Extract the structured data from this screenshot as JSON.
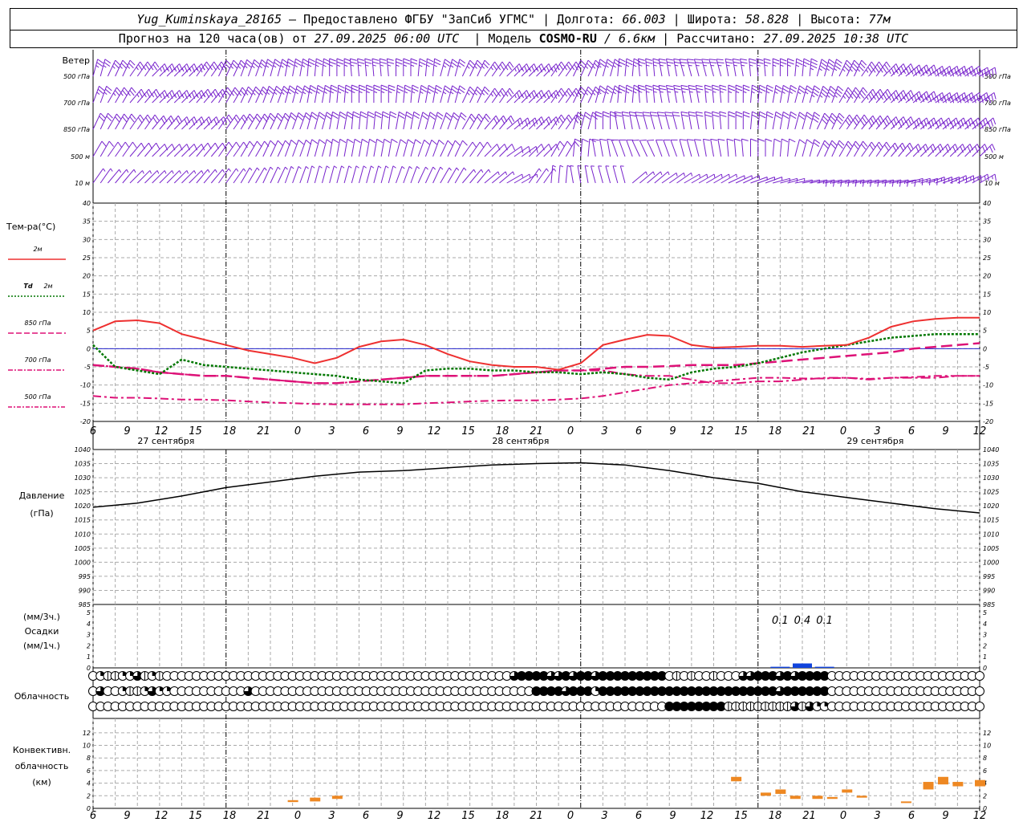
{
  "header": {
    "station": "Yug_Kuminskaya_28165",
    "provider": "– Предоставлено ФГБУ \"ЗапСиб УГМС\"",
    "lon_label": "Долгота:",
    "lon": "66.003",
    "lat_label": "Широта:",
    "lat": "58.828",
    "alt_label": "Высота:",
    "alt": "77м",
    "forecast_prefix": "Прогноз на 120 часа(ов) от",
    "forecast_time": "27.09.2025 06:00 UTC",
    "model_label": "Модель",
    "model": "COSMO-RU",
    "resolution": "/ 6.6км",
    "calc_label": "Рассчитано:",
    "calc_time": "27.09.2025 10:38 UTC"
  },
  "colors": {
    "t2m": "#ee3030",
    "td2m": "#007700",
    "t850": "#dd1177",
    "t700": "#dd1177",
    "t500": "#dd1177",
    "zero_line": "#2222cc",
    "wind": "#7722cc",
    "pressure": "#000000",
    "precip": "#1144dd",
    "convective": "#ee8822"
  },
  "wind_panel": {
    "title": "Ветер",
    "levels": [
      "500 гПа",
      "700 гПа",
      "850 гПа",
      "500 м",
      "10 м"
    ]
  },
  "temp_panel": {
    "title": "Тем-ра(°C)",
    "legend": [
      {
        "key": "t2m",
        "label": "2м"
      },
      {
        "key": "td2m",
        "label_prefix": "Td",
        "label": "2м"
      },
      {
        "key": "t850",
        "label": "850 гПа"
      },
      {
        "key": "t700",
        "label": "700 гПа"
      },
      {
        "key": "t500",
        "label": "500 гПа"
      }
    ],
    "yticks": [
      "40",
      "35",
      "30",
      "25",
      "20",
      "15",
      "10",
      "5",
      "0",
      "-5",
      "-10",
      "-15",
      "-20"
    ],
    "dates": [
      "27 сентября",
      "28 сентября",
      "29 сентября"
    ]
  },
  "pressure_panel": {
    "title": "Давление",
    "unit": "(гПа)",
    "yticks": [
      "1040",
      "1035",
      "1030",
      "1025",
      "1020",
      "1015",
      "1010",
      "1005",
      "1000",
      "995",
      "990",
      "985"
    ]
  },
  "precip_panel": {
    "unit1": "(мм/3ч.)",
    "title": "Осадки",
    "unit2": "(мм/1ч.)",
    "yticks": [
      "5",
      "4",
      "3",
      "2",
      "1",
      "0"
    ],
    "annotations": [
      "0.1",
      "0.4",
      "0.1"
    ]
  },
  "cloud_panel": {
    "title": "Облачность"
  },
  "conv_panel": {
    "title1": "Конвективн.",
    "title2": "облачность",
    "unit": "(км)",
    "yticks": [
      "12",
      "10",
      "8",
      "6",
      "4",
      "2",
      "0"
    ]
  },
  "x_ticks": [
    "6",
    "9",
    "12",
    "15",
    "18",
    "21",
    "0",
    "3",
    "6",
    "9",
    "12",
    "15",
    "18",
    "21",
    "0",
    "3",
    "6",
    "9",
    "12",
    "15",
    "18",
    "21",
    "0",
    "3",
    "6",
    "9",
    "12"
  ],
  "chart_data": [
    {
      "type": "line",
      "title": "Тем-ра(°C)",
      "x": [
        0,
        3,
        6,
        9,
        12,
        15,
        18,
        21,
        24,
        27,
        30,
        33,
        36,
        39,
        42,
        45,
        48,
        51,
        54,
        57,
        60,
        63,
        66,
        69,
        72,
        75,
        78,
        81,
        84,
        87,
        90,
        93,
        96,
        99,
        102,
        105,
        108,
        111,
        114,
        117,
        120
      ],
      "x_unit": "hours from 27.09.2025 06 UTC",
      "ylim": [
        -20,
        40
      ],
      "series": [
        {
          "name": "2м",
          "values": [
            5,
            7.5,
            7.8,
            7,
            4,
            2.5,
            1,
            -0.5,
            -1.5,
            -2.5,
            -4,
            -2.5,
            0.5,
            2,
            2.5,
            1,
            -1.5,
            -3.5,
            -4.5,
            -5,
            -5,
            -5.8,
            -4,
            1,
            2.5,
            3.8,
            3.5,
            1,
            0.3,
            0.5,
            0.8,
            0.8,
            0.5,
            0.8,
            1,
            3,
            6,
            7.5,
            8.2,
            8.5,
            8.5
          ]
        },
        {
          "name": "Td 2м",
          "values": [
            1,
            -5,
            -6,
            -7,
            -3,
            -4.5,
            -5,
            -5.5,
            -6,
            -6.5,
            -7,
            -7.5,
            -8.5,
            -9,
            -9.5,
            -6,
            -5.5,
            -5.5,
            -6,
            -6,
            -6.5,
            -6.5,
            -7,
            -6.5,
            -7,
            -8,
            -8.5,
            -6.5,
            -5.5,
            -5,
            -4,
            -2.5,
            -1,
            0,
            1,
            2,
            3,
            3.5,
            4,
            4,
            4
          ]
        },
        {
          "name": "850 гПа",
          "values": [
            -4.5,
            -5,
            -5.5,
            -6.5,
            -7,
            -7.5,
            -7.5,
            -8,
            -8.5,
            -9,
            -9.5,
            -9.5,
            -9,
            -8.5,
            -8,
            -7.5,
            -7.5,
            -7.5,
            -7.5,
            -7,
            -6.5,
            -6,
            -6,
            -5.5,
            -5,
            -5,
            -4.8,
            -4.5,
            -4.5,
            -4.5,
            -4,
            -3.5,
            -3,
            -2.5,
            -2,
            -1.5,
            -1,
            0,
            0.5,
            1,
            1.5
          ]
        },
        {
          "name": "700 гПа",
          "values": [
            -4.5,
            -5,
            -5.5,
            -6.5,
            -7,
            -7.5,
            -7.5,
            -8,
            -8.5,
            -9,
            -9.5,
            -9.5,
            -9,
            -8.5,
            -8,
            -7.5,
            -7.5,
            -7.5,
            -7.5,
            -7,
            -6.5,
            -6,
            -6,
            -6,
            -7,
            -7.5,
            -7.5,
            -8.5,
            -9.5,
            -9.5,
            -9,
            -9,
            -8.5,
            -8,
            -8,
            -8.5,
            -8,
            -8,
            -8,
            -7.5,
            -7.5
          ]
        },
        {
          "name": "500 гПа",
          "values": [
            -13,
            -13.5,
            -13.5,
            -13.7,
            -14,
            -14,
            -14.2,
            -14.5,
            -14.8,
            -15,
            -15.2,
            -15.3,
            -15.3,
            -15.3,
            -15.3,
            -15,
            -14.8,
            -14.5,
            -14.3,
            -14.2,
            -14.2,
            -14,
            -13.7,
            -13,
            -12,
            -11,
            -10,
            -9.5,
            -9,
            -8.5,
            -8,
            -8,
            -8.2,
            -8.2,
            -8,
            -8.3,
            -8,
            -7.8,
            -7.5,
            -7.5,
            -7.5
          ]
        }
      ]
    },
    {
      "type": "line",
      "title": "Давление",
      "ylabel": "(гПа)",
      "ylim": [
        985,
        1040
      ],
      "x": [
        0,
        6,
        12,
        18,
        24,
        30,
        36,
        42,
        48,
        54,
        60,
        66,
        72,
        78,
        84,
        90,
        96,
        102,
        108,
        114,
        120
      ],
      "series": [
        {
          "name": "Давление",
          "values": [
            1019.5,
            1021,
            1023.5,
            1026.5,
            1028.5,
            1030.5,
            1032,
            1032.5,
            1033.5,
            1034.5,
            1035,
            1035.3,
            1034.5,
            1032.5,
            1030,
            1028,
            1025,
            1023,
            1021,
            1019,
            1017.5
          ]
        }
      ]
    },
    {
      "type": "bar",
      "title": "Осадки",
      "ylim": [
        0,
        5
      ],
      "x": [
        93,
        96,
        99
      ],
      "values": [
        0.1,
        0.4,
        0.1
      ]
    },
    {
      "type": "bar",
      "title": "Конвективн. облачность",
      "ylabel": "(км)",
      "ylim": [
        0,
        13
      ],
      "bars": [
        {
          "x": 27,
          "base": 1,
          "top": 1.3
        },
        {
          "x": 30,
          "base": 1.1,
          "top": 1.7
        },
        {
          "x": 33,
          "base": 1.5,
          "top": 2
        },
        {
          "x": 87,
          "base": 4.3,
          "top": 5
        },
        {
          "x": 91,
          "base": 2,
          "top": 2.5
        },
        {
          "x": 93,
          "base": 2.3,
          "top": 3
        },
        {
          "x": 95,
          "base": 1.5,
          "top": 2
        },
        {
          "x": 98,
          "base": 1.5,
          "top": 2
        },
        {
          "x": 100,
          "base": 1.5,
          "top": 1.8
        },
        {
          "x": 102,
          "base": 2.5,
          "top": 3
        },
        {
          "x": 104,
          "base": 1.7,
          "top": 2
        },
        {
          "x": 110,
          "base": 0.9,
          "top": 1.1
        },
        {
          "x": 113,
          "base": 3,
          "top": 4.2
        },
        {
          "x": 115,
          "base": 3.8,
          "top": 5
        },
        {
          "x": 117,
          "base": 3.5,
          "top": 4.2
        },
        {
          "x": 120,
          "base": 3.5,
          "top": 4.5
        }
      ]
    }
  ]
}
